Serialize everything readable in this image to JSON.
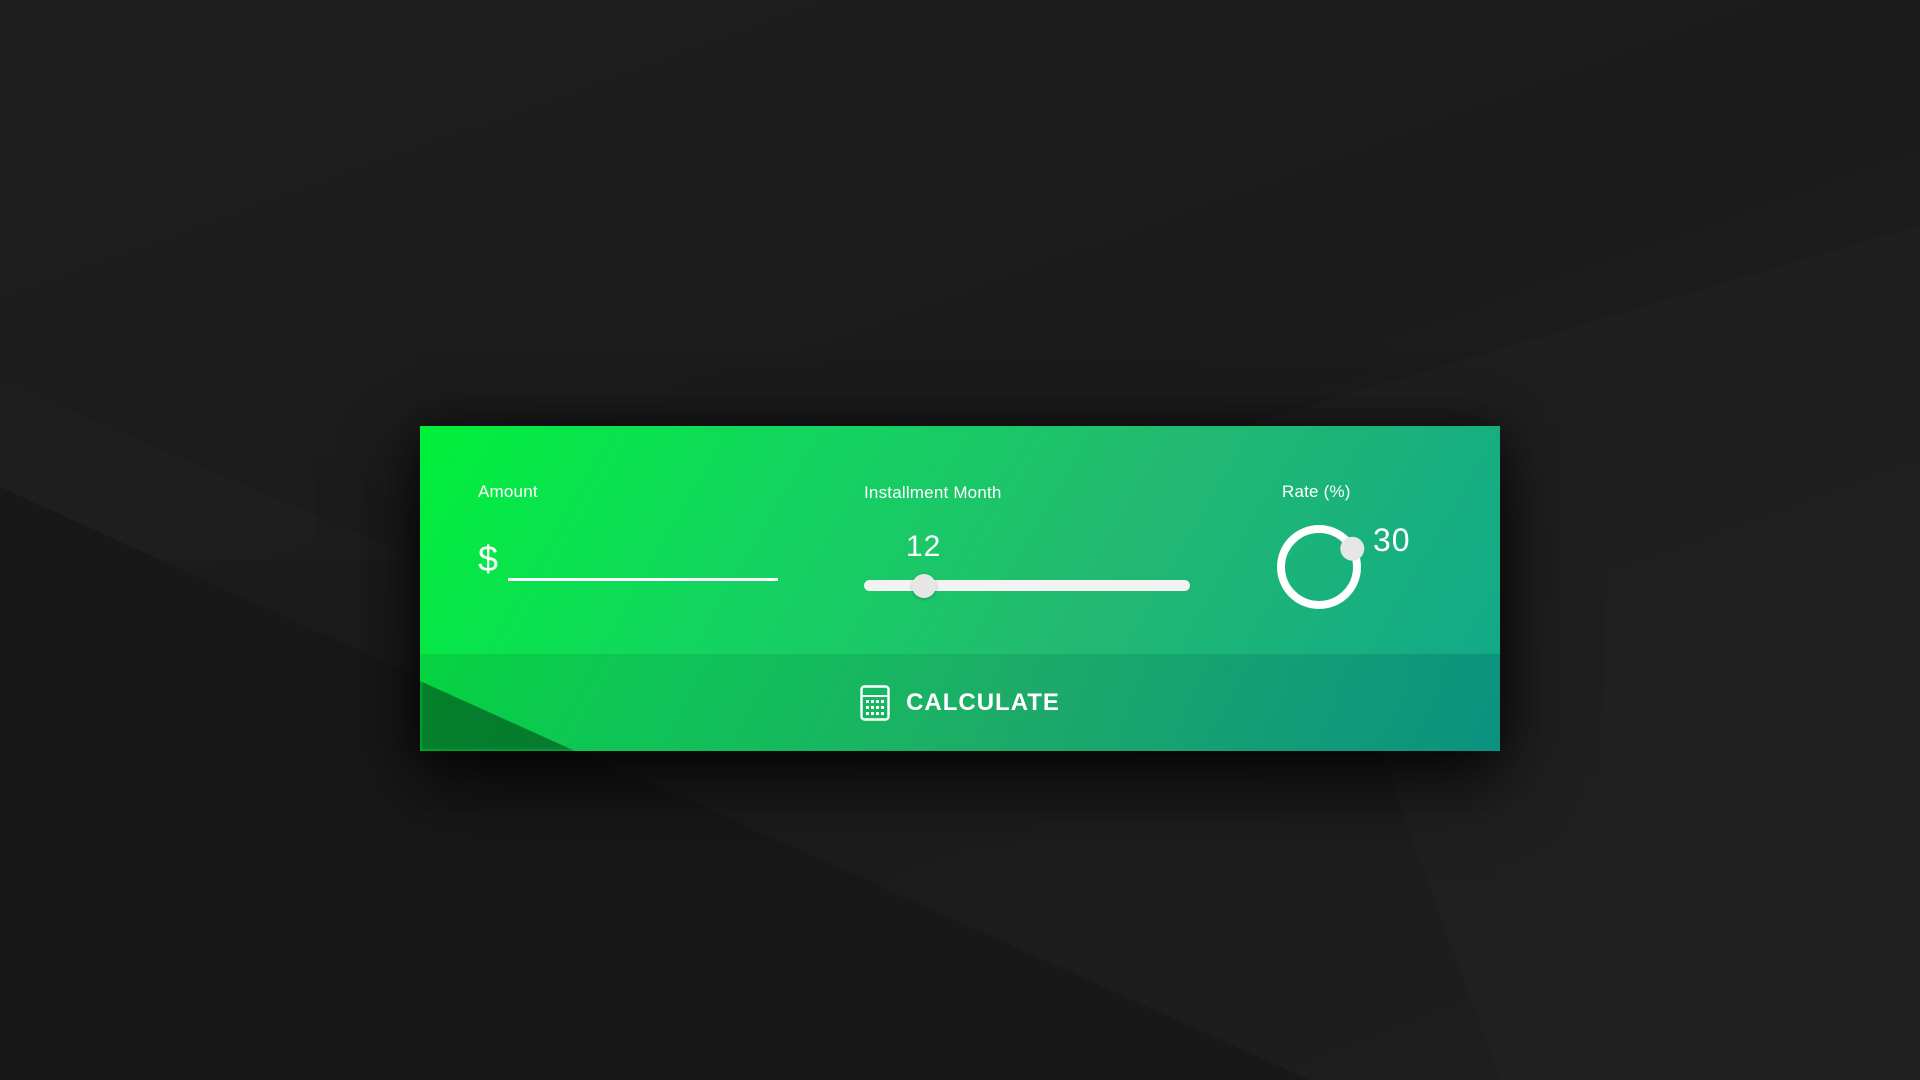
{
  "amount": {
    "label": "Amount",
    "currency_symbol": "$",
    "value": "",
    "placeholder": ""
  },
  "installment": {
    "label": "Installment Month",
    "value": "12",
    "slider_fraction": 0.185
  },
  "rate": {
    "label": "Rate (%)",
    "value": "30",
    "dial_fraction": 0.17
  },
  "calculate": {
    "label": "CALCULATE",
    "icon": "calculator-icon"
  },
  "colors": {
    "background": "#1d1d1d",
    "card_gradient_start": "#00f03a",
    "card_gradient_end": "#0fa88a",
    "foreground": "#ffffff",
    "knob": "#e6e6e6"
  }
}
